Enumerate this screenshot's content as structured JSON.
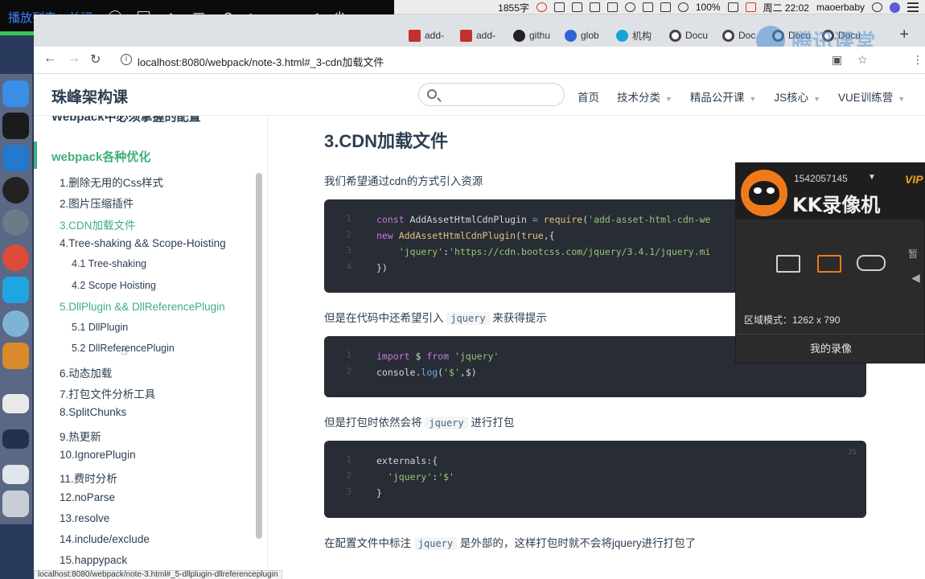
{
  "menubar": {
    "word_count": "1855字",
    "battery": "100%",
    "date_time": "周二 22:02",
    "user": "maoerbaby"
  },
  "overlay": {
    "title": "播放列表：关闭"
  },
  "browser": {
    "tabs": [
      {
        "label": "add-",
        "icon": "pdf-red-icon"
      },
      {
        "label": "add-",
        "icon": "pdf-red-icon"
      },
      {
        "label": "githu",
        "icon": "github-icon"
      },
      {
        "label": "glob",
        "icon": "baidu-paw-icon"
      },
      {
        "label": "机构",
        "icon": "shield-icon"
      },
      {
        "label": "Docu",
        "icon": "document-icon"
      },
      {
        "label": "Doc",
        "icon": "document-icon"
      },
      {
        "label": "Docu",
        "icon": "document-icon"
      },
      {
        "label": "Docu",
        "icon": "document-icon"
      }
    ],
    "new_tab": "+",
    "watermark_text": "腾讯课堂",
    "url": "localhost:8080/webpack/note-3.html#_3-cdn加载文件",
    "status_url": "localhost:8080/webpack/note-3.html#_5-dllplugin-dllreferenceplugin"
  },
  "site": {
    "title": "珠峰架构课",
    "search_placeholder": "",
    "nav": [
      {
        "label": "首页",
        "caret": false
      },
      {
        "label": "技术分类",
        "caret": true
      },
      {
        "label": "精品公开课",
        "caret": true
      },
      {
        "label": "JS核心",
        "caret": true
      },
      {
        "label": "VUE训练营",
        "caret": true
      }
    ]
  },
  "sidebar": {
    "prev_heading": "Webpack中必须掌握的配置",
    "section": "webpack各种优化",
    "items": [
      {
        "label": "1.删除无用的Css样式",
        "level": 1,
        "active": false
      },
      {
        "label": "2.图片压缩插件",
        "level": 1,
        "active": false
      },
      {
        "label": "3.CDN加载文件",
        "level": 1,
        "active": true
      },
      {
        "label": "4.Tree-shaking && Scope-Hoisting",
        "level": 1,
        "active": false
      },
      {
        "label": "4.1 Tree-shaking",
        "level": 2,
        "active": false
      },
      {
        "label": "4.2 Scope Hoisting",
        "level": 2,
        "active": false
      },
      {
        "label": "5.DllPlugin && DllReferencePlugin",
        "level": 1,
        "active": true
      },
      {
        "label": "5.1 DllPlugin",
        "level": 2,
        "active": false
      },
      {
        "label": "5.2 DllReferencePlugin",
        "level": 2,
        "active": false
      },
      {
        "label": "6.动态加载",
        "level": 1,
        "active": false
      },
      {
        "label": "7.打包文件分析工具",
        "level": 1,
        "active": false
      },
      {
        "label": "8.SplitChunks",
        "level": 1,
        "active": false
      },
      {
        "label": "9.热更新",
        "level": 1,
        "active": false
      },
      {
        "label": "10.IgnorePlugin",
        "level": 1,
        "active": false
      },
      {
        "label": "11.费时分析",
        "level": 1,
        "active": false
      },
      {
        "label": "12.noParse",
        "level": 1,
        "active": false
      },
      {
        "label": "13.resolve",
        "level": 1,
        "active": false
      },
      {
        "label": "14.include/exclude",
        "level": 1,
        "active": false
      },
      {
        "label": "15.happypack",
        "level": 1,
        "active": false
      }
    ]
  },
  "content": {
    "heading": "3.CDN加载文件",
    "p1": "我们希望通过cdn的方式引入资源",
    "code1": [
      {
        "n": "1",
        "tokens": [
          [
            "kw",
            "const "
          ],
          [
            "pl",
            "AddAssetHtmlCdnPlugin "
          ],
          [
            "cf",
            "= "
          ],
          [
            "fn",
            "require"
          ],
          [
            "pl",
            "("
          ],
          [
            "str",
            "'add-asset-html-cdn-we"
          ]
        ]
      },
      {
        "n": "2",
        "tokens": [
          [
            "kw",
            "new "
          ],
          [
            "fn",
            "AddAssetHtmlCdnPlugin"
          ],
          [
            "pl",
            "("
          ],
          [
            "fn",
            "true"
          ],
          [
            "pl",
            ",{"
          ]
        ]
      },
      {
        "n": "3",
        "tokens": [
          [
            "pl",
            "    "
          ],
          [
            "str",
            "'jquery'"
          ],
          [
            "pl",
            ":"
          ],
          [
            "str",
            "'https://cdn.bootcss.com/jquery/3.4.1/jquery.mi"
          ]
        ]
      },
      {
        "n": "4",
        "tokens": [
          [
            "pl",
            "})"
          ]
        ]
      }
    ],
    "p2_before": "但是在代码中还希望引入",
    "p2_code": "jquery",
    "p2_after": "来获得提示",
    "code2": [
      {
        "n": "1",
        "tokens": [
          [
            "kw",
            "import "
          ],
          [
            "pl",
            "$ "
          ],
          [
            "kw",
            "from "
          ],
          [
            "str",
            "'jquery'"
          ]
        ]
      },
      {
        "n": "2",
        "tokens": [
          [
            "pl",
            "console."
          ],
          [
            "cf",
            "log"
          ],
          [
            "pl",
            "("
          ],
          [
            "str",
            "'$'"
          ],
          [
            "pl",
            ",$)"
          ]
        ]
      }
    ],
    "p3_before": "但是打包时依然会将",
    "p3_code": "jquery",
    "p3_after": "进行打包",
    "code3_lang": "JS",
    "code3": [
      {
        "n": "1",
        "tokens": [
          [
            "pl",
            "externals:{"
          ]
        ]
      },
      {
        "n": "2",
        "tokens": [
          [
            "pl",
            "  "
          ],
          [
            "str",
            "'jquery'"
          ],
          [
            "pl",
            ":"
          ],
          [
            "str",
            "'$'"
          ]
        ]
      },
      {
        "n": "3",
        "tokens": [
          [
            "pl",
            "}"
          ]
        ]
      }
    ],
    "p4_before": "在配置文件中标注",
    "p4_code": "jquery",
    "p4_after": "是外部的，这样打包时就不会将jquery进行打包了"
  },
  "recorder": {
    "account": "1542057145",
    "vip": "VIP",
    "brand": "KK录像机",
    "side_label": "暂",
    "region_mode": "区域模式：1262 x 790",
    "my_videos": "我的录像"
  },
  "colors": {
    "accent": "#3eaf7c",
    "code_bg": "#282c34",
    "recorder_orange": "#f07a1a"
  }
}
